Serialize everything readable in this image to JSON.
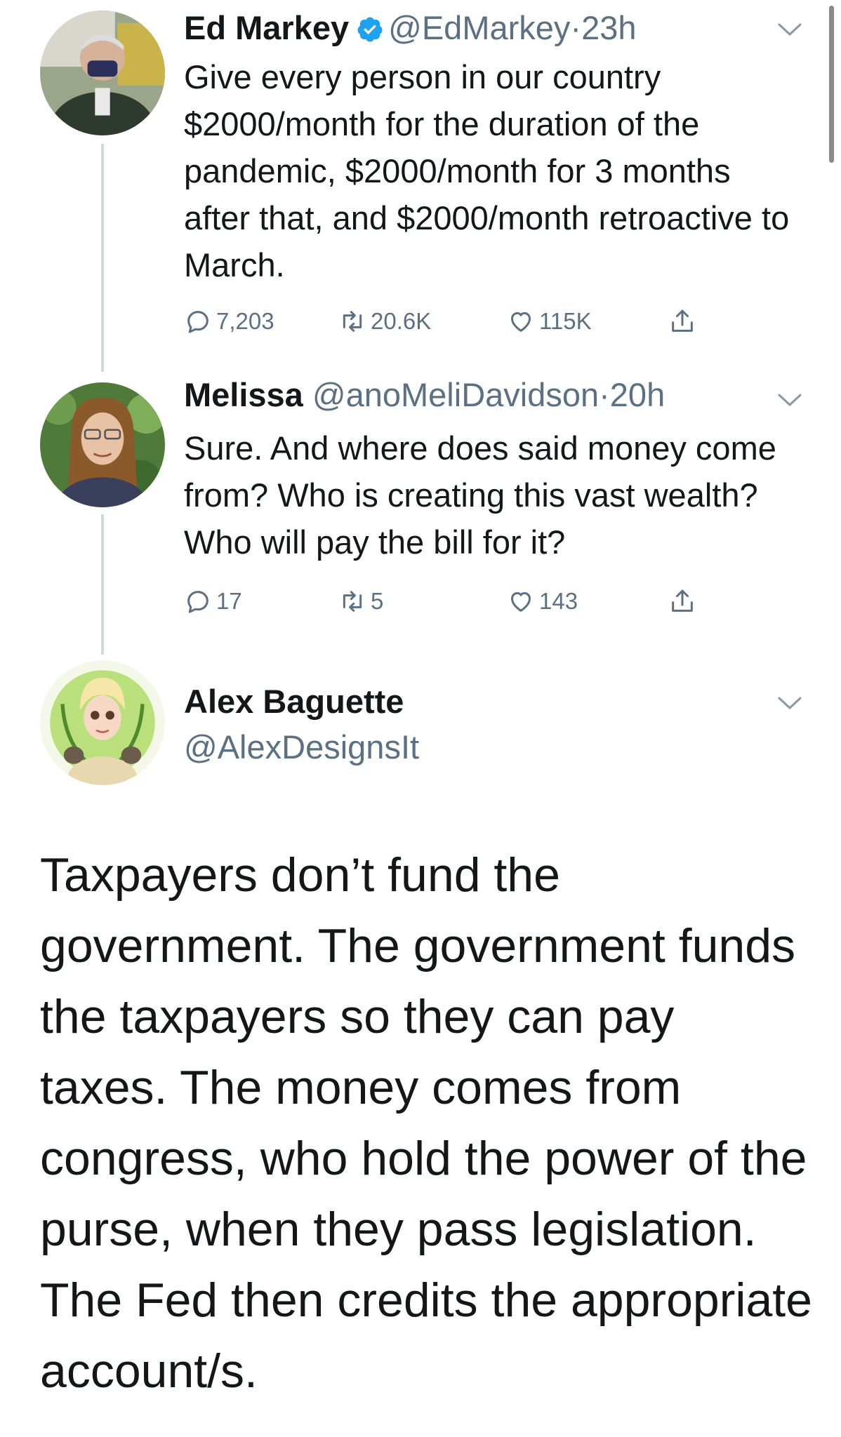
{
  "tweets": [
    {
      "name": "Ed Markey",
      "verified": true,
      "handle": "@EdMarkey",
      "separator": "·",
      "time": "23h",
      "text": "Give every person in our country $2000/month for the duration of the pandemic, $2000/month for 3 months after that, and $2000/month retroactive to March.",
      "replies": "7,203",
      "retweets": "20.6K",
      "likes": "115K"
    },
    {
      "name": "Melissa",
      "handle": "@anoMeliDavidson",
      "separator": "·",
      "time": "20h",
      "text": "Sure.  And where does said money come from?  Who is creating this vast wealth?  Who will pay the bill for it?",
      "replies": "17",
      "retweets": "5",
      "likes": "143"
    }
  ],
  "focused_tweet": {
    "name": "Alex Baguette",
    "handle": "@AlexDesignsIt",
    "text": "Taxpayers don’t fund the government. The government funds the taxpayers so they can pay taxes. The money comes from congress, who hold the power of the purse, when they pass legislation. The Fed then credits the appropriate account/s."
  },
  "colors": {
    "text": "#14171a",
    "secondary": "#5b7083",
    "verified": "#1da1f2",
    "thread_line": "#cfd9de"
  },
  "icons": [
    "reply-icon",
    "retweet-icon",
    "like-icon",
    "share-icon",
    "chevron-down-icon",
    "verified-badge-icon"
  ]
}
